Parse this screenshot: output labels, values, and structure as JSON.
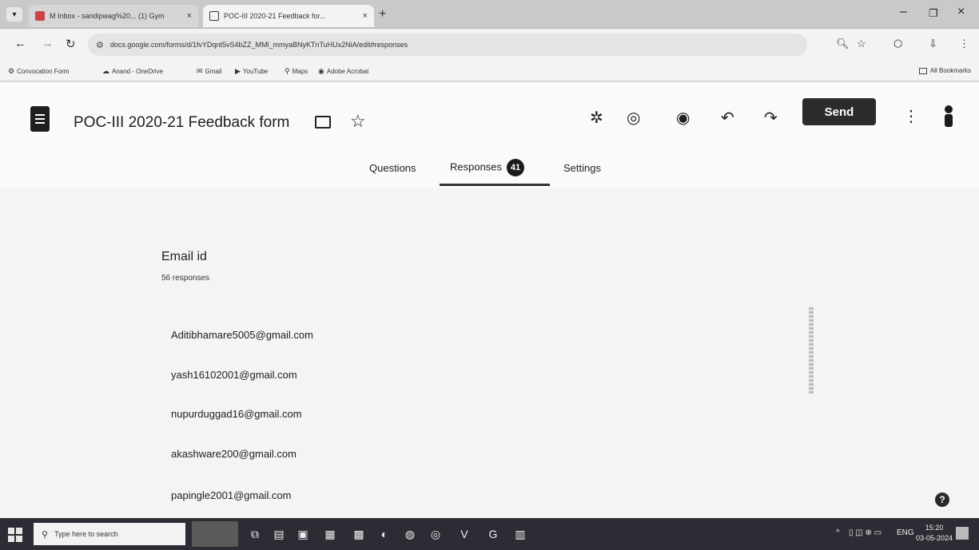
{
  "browser": {
    "tabs": [
      {
        "label": "M Inbox - sandipwag%20... (1) Gym",
        "close": "×"
      },
      {
        "label": "POC-III 2020-21 Feedback for...",
        "close": "×"
      }
    ],
    "new_tab": "+",
    "window_controls": {
      "minimize": "–",
      "maximize": "❐",
      "close": "×"
    },
    "url": "docs.google.com/forms/d/1fvYDqnt5vS4bZZ_MMl_mmyaBNyKTnTuHUx2NiA/edit#responses",
    "bookmarks": [
      {
        "label": "Convocation Form",
        "icon": "gear-icon"
      },
      {
        "label": "Anand - OneDrive",
        "icon": "cloud-icon"
      },
      {
        "label": "Gmail",
        "icon": "gmail-icon"
      },
      {
        "label": "YouTube",
        "icon": "youtube-icon"
      },
      {
        "label": "Maps",
        "icon": "maps-icon"
      },
      {
        "label": "Adobe Acrobat",
        "icon": "acrobat-icon"
      }
    ],
    "all_bookmarks": "All Bookmarks"
  },
  "form": {
    "title": "POC-III 2020-21 Feedback form",
    "send_label": "Send",
    "tabs": {
      "questions": "Questions",
      "responses": "Responses",
      "settings": "Settings"
    },
    "response_badge": "41",
    "question": {
      "title": "Email id",
      "count_text": "56 responses",
      "responses": [
        "Aditibhamare5005@gmail.com",
        "yash16102001@gmail.com",
        "nupurduggad16@gmail.com",
        "akashware200@gmail.com",
        "papingle2001@gmail.com"
      ]
    }
  },
  "taskbar": {
    "search_placeholder": "Type here to search",
    "tray_lang": "ENG",
    "time": "15:20",
    "date": "03-05-2024"
  }
}
